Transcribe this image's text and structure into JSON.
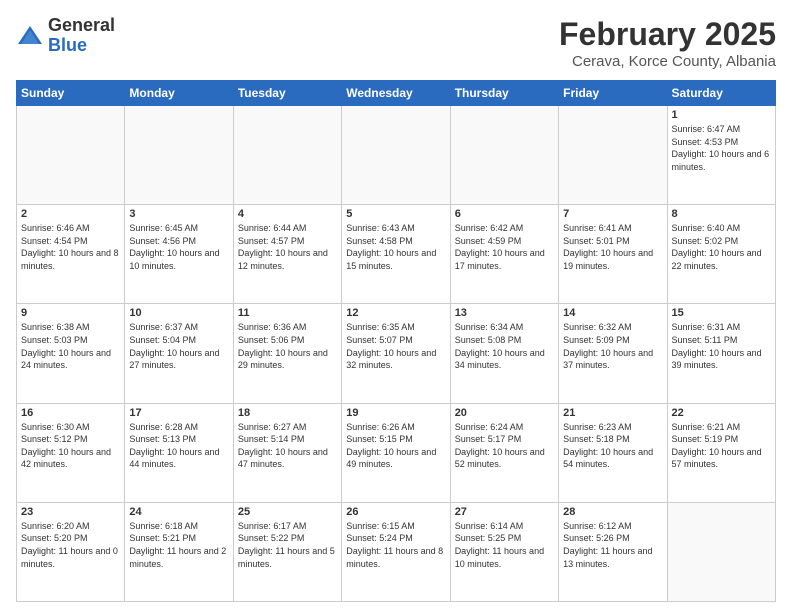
{
  "logo": {
    "general": "General",
    "blue": "Blue"
  },
  "header": {
    "title": "February 2025",
    "subtitle": "Cerava, Korce County, Albania"
  },
  "days_of_week": [
    "Sunday",
    "Monday",
    "Tuesday",
    "Wednesday",
    "Thursday",
    "Friday",
    "Saturday"
  ],
  "weeks": [
    [
      {
        "num": "",
        "info": ""
      },
      {
        "num": "",
        "info": ""
      },
      {
        "num": "",
        "info": ""
      },
      {
        "num": "",
        "info": ""
      },
      {
        "num": "",
        "info": ""
      },
      {
        "num": "",
        "info": ""
      },
      {
        "num": "1",
        "info": "Sunrise: 6:47 AM\nSunset: 4:53 PM\nDaylight: 10 hours and 6 minutes."
      }
    ],
    [
      {
        "num": "2",
        "info": "Sunrise: 6:46 AM\nSunset: 4:54 PM\nDaylight: 10 hours and 8 minutes."
      },
      {
        "num": "3",
        "info": "Sunrise: 6:45 AM\nSunset: 4:56 PM\nDaylight: 10 hours and 10 minutes."
      },
      {
        "num": "4",
        "info": "Sunrise: 6:44 AM\nSunset: 4:57 PM\nDaylight: 10 hours and 12 minutes."
      },
      {
        "num": "5",
        "info": "Sunrise: 6:43 AM\nSunset: 4:58 PM\nDaylight: 10 hours and 15 minutes."
      },
      {
        "num": "6",
        "info": "Sunrise: 6:42 AM\nSunset: 4:59 PM\nDaylight: 10 hours and 17 minutes."
      },
      {
        "num": "7",
        "info": "Sunrise: 6:41 AM\nSunset: 5:01 PM\nDaylight: 10 hours and 19 minutes."
      },
      {
        "num": "8",
        "info": "Sunrise: 6:40 AM\nSunset: 5:02 PM\nDaylight: 10 hours and 22 minutes."
      }
    ],
    [
      {
        "num": "9",
        "info": "Sunrise: 6:38 AM\nSunset: 5:03 PM\nDaylight: 10 hours and 24 minutes."
      },
      {
        "num": "10",
        "info": "Sunrise: 6:37 AM\nSunset: 5:04 PM\nDaylight: 10 hours and 27 minutes."
      },
      {
        "num": "11",
        "info": "Sunrise: 6:36 AM\nSunset: 5:06 PM\nDaylight: 10 hours and 29 minutes."
      },
      {
        "num": "12",
        "info": "Sunrise: 6:35 AM\nSunset: 5:07 PM\nDaylight: 10 hours and 32 minutes."
      },
      {
        "num": "13",
        "info": "Sunrise: 6:34 AM\nSunset: 5:08 PM\nDaylight: 10 hours and 34 minutes."
      },
      {
        "num": "14",
        "info": "Sunrise: 6:32 AM\nSunset: 5:09 PM\nDaylight: 10 hours and 37 minutes."
      },
      {
        "num": "15",
        "info": "Sunrise: 6:31 AM\nSunset: 5:11 PM\nDaylight: 10 hours and 39 minutes."
      }
    ],
    [
      {
        "num": "16",
        "info": "Sunrise: 6:30 AM\nSunset: 5:12 PM\nDaylight: 10 hours and 42 minutes."
      },
      {
        "num": "17",
        "info": "Sunrise: 6:28 AM\nSunset: 5:13 PM\nDaylight: 10 hours and 44 minutes."
      },
      {
        "num": "18",
        "info": "Sunrise: 6:27 AM\nSunset: 5:14 PM\nDaylight: 10 hours and 47 minutes."
      },
      {
        "num": "19",
        "info": "Sunrise: 6:26 AM\nSunset: 5:15 PM\nDaylight: 10 hours and 49 minutes."
      },
      {
        "num": "20",
        "info": "Sunrise: 6:24 AM\nSunset: 5:17 PM\nDaylight: 10 hours and 52 minutes."
      },
      {
        "num": "21",
        "info": "Sunrise: 6:23 AM\nSunset: 5:18 PM\nDaylight: 10 hours and 54 minutes."
      },
      {
        "num": "22",
        "info": "Sunrise: 6:21 AM\nSunset: 5:19 PM\nDaylight: 10 hours and 57 minutes."
      }
    ],
    [
      {
        "num": "23",
        "info": "Sunrise: 6:20 AM\nSunset: 5:20 PM\nDaylight: 11 hours and 0 minutes."
      },
      {
        "num": "24",
        "info": "Sunrise: 6:18 AM\nSunset: 5:21 PM\nDaylight: 11 hours and 2 minutes."
      },
      {
        "num": "25",
        "info": "Sunrise: 6:17 AM\nSunset: 5:22 PM\nDaylight: 11 hours and 5 minutes."
      },
      {
        "num": "26",
        "info": "Sunrise: 6:15 AM\nSunset: 5:24 PM\nDaylight: 11 hours and 8 minutes."
      },
      {
        "num": "27",
        "info": "Sunrise: 6:14 AM\nSunset: 5:25 PM\nDaylight: 11 hours and 10 minutes."
      },
      {
        "num": "28",
        "info": "Sunrise: 6:12 AM\nSunset: 5:26 PM\nDaylight: 11 hours and 13 minutes."
      },
      {
        "num": "",
        "info": ""
      }
    ]
  ]
}
